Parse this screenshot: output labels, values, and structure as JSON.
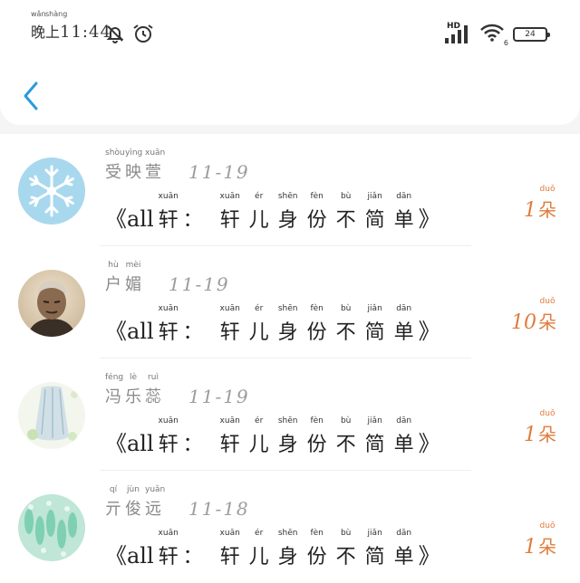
{
  "status_bar": {
    "time_hanzi": [
      "晚",
      "上"
    ],
    "time_pinyin": [
      "wǎn",
      "shàng"
    ],
    "time_digits": "11:44",
    "network_label": "HD",
    "wifi_sub": "6",
    "battery_level": "24",
    "icons": [
      "bell-muted-icon",
      "alarm-clock-icon",
      "signal-icon",
      "wifi-icon",
      "battery-icon"
    ]
  },
  "header": {
    "back_icon": "chevron-left-icon"
  },
  "colors": {
    "accent": "#2b9bdc",
    "count": "#e07b3c",
    "date": "#9c9c9c"
  },
  "entries": [
    {
      "name_chars": [
        "受",
        "映",
        "萱"
      ],
      "name_pinyin": [
        "shòu",
        "yìng",
        "xuān"
      ],
      "date": "11-19",
      "title_open": "《all",
      "title_first": "轩",
      "title_first_py": "xuān",
      "title_colon": "：",
      "title_chars": [
        "轩",
        "儿",
        "身",
        "份",
        "不",
        "简",
        "单"
      ],
      "title_pinyin": [
        "xuān",
        "ér",
        "shēn",
        "fèn",
        "bù",
        "jiǎn",
        "dān"
      ],
      "title_close": "》",
      "count": "1",
      "unit": "朵",
      "unit_py": "duǒ",
      "avatar": "snowflake"
    },
    {
      "name_chars": [
        "户",
        "媚"
      ],
      "name_pinyin": [
        "hù",
        "mèi"
      ],
      "date": "11-19",
      "title_open": "《all",
      "title_first": "轩",
      "title_first_py": "xuān",
      "title_colon": "：",
      "title_chars": [
        "轩",
        "儿",
        "身",
        "份",
        "不",
        "简",
        "单"
      ],
      "title_pinyin": [
        "xuān",
        "ér",
        "shēn",
        "fèn",
        "bù",
        "jiǎn",
        "dān"
      ],
      "title_close": "》",
      "count": "10",
      "unit": "朵",
      "unit_py": "duǒ",
      "avatar": "portrait"
    },
    {
      "name_chars": [
        "冯",
        "乐",
        "蕊"
      ],
      "name_pinyin": [
        "féng",
        "lè",
        "ruì"
      ],
      "date": "11-19",
      "title_open": "《all",
      "title_first": "轩",
      "title_first_py": "xuān",
      "title_colon": "：",
      "title_chars": [
        "轩",
        "儿",
        "身",
        "份",
        "不",
        "简",
        "单"
      ],
      "title_pinyin": [
        "xuān",
        "ér",
        "shēn",
        "fèn",
        "bù",
        "jiǎn",
        "dān"
      ],
      "title_close": "》",
      "count": "1",
      "unit": "朵",
      "unit_py": "duǒ",
      "avatar": "illustration"
    },
    {
      "name_chars": [
        "亓",
        "俊",
        "远"
      ],
      "name_pinyin": [
        "qí",
        "jùn",
        "yuǎn"
      ],
      "date": "11-18",
      "title_open": "《all",
      "title_first": "轩",
      "title_first_py": "xuān",
      "title_colon": "：",
      "title_chars": [
        "轩",
        "儿",
        "身",
        "份",
        "不",
        "简",
        "单"
      ],
      "title_pinyin": [
        "xuān",
        "ér",
        "shēn",
        "fèn",
        "bù",
        "jiǎn",
        "dān"
      ],
      "title_close": "》",
      "count": "1",
      "unit": "朵",
      "unit_py": "duǒ",
      "avatar": "teal-pattern"
    }
  ]
}
